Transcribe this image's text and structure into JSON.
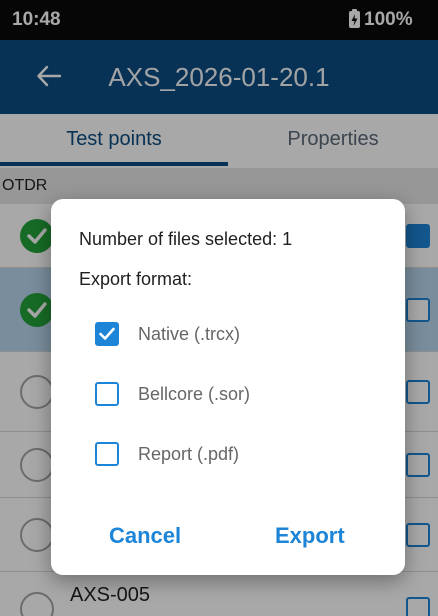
{
  "status_bar": {
    "time": "10:48",
    "battery": "100%"
  },
  "app_bar": {
    "title": "AXS_2026-01-20.1"
  },
  "tabs": [
    {
      "label": "Test points",
      "active": true
    },
    {
      "label": "Properties",
      "active": false
    }
  ],
  "section": {
    "label": "OTDR"
  },
  "rows": [
    {
      "name": "",
      "status": "done",
      "checked": true
    },
    {
      "name": "",
      "status": "done",
      "checked": false,
      "selected": true
    },
    {
      "name": "",
      "status": "empty",
      "checked": false
    },
    {
      "name": "",
      "status": "empty",
      "checked": false
    },
    {
      "name": "",
      "status": "empty",
      "checked": false
    },
    {
      "name": "AXS-005",
      "status": "empty",
      "checked": false
    }
  ],
  "dialog": {
    "files_selected": "Number of files selected: 1",
    "format_label": "Export format:",
    "options": [
      {
        "label": "Native (.trcx)",
        "checked": true
      },
      {
        "label": "Bellcore (.sor)",
        "checked": false
      },
      {
        "label": "Report (.pdf)",
        "checked": false
      }
    ],
    "cancel_label": "Cancel",
    "export_label": "Export"
  },
  "colors": {
    "app_bar": "#0d4d82",
    "accent": "#1c85d7",
    "done_green": "#23a33a",
    "selected_row": "#b8d6ee"
  },
  "icons": [
    "battery-charging-icon",
    "back-arrow-icon",
    "check-icon",
    "checkbox-icon"
  ]
}
